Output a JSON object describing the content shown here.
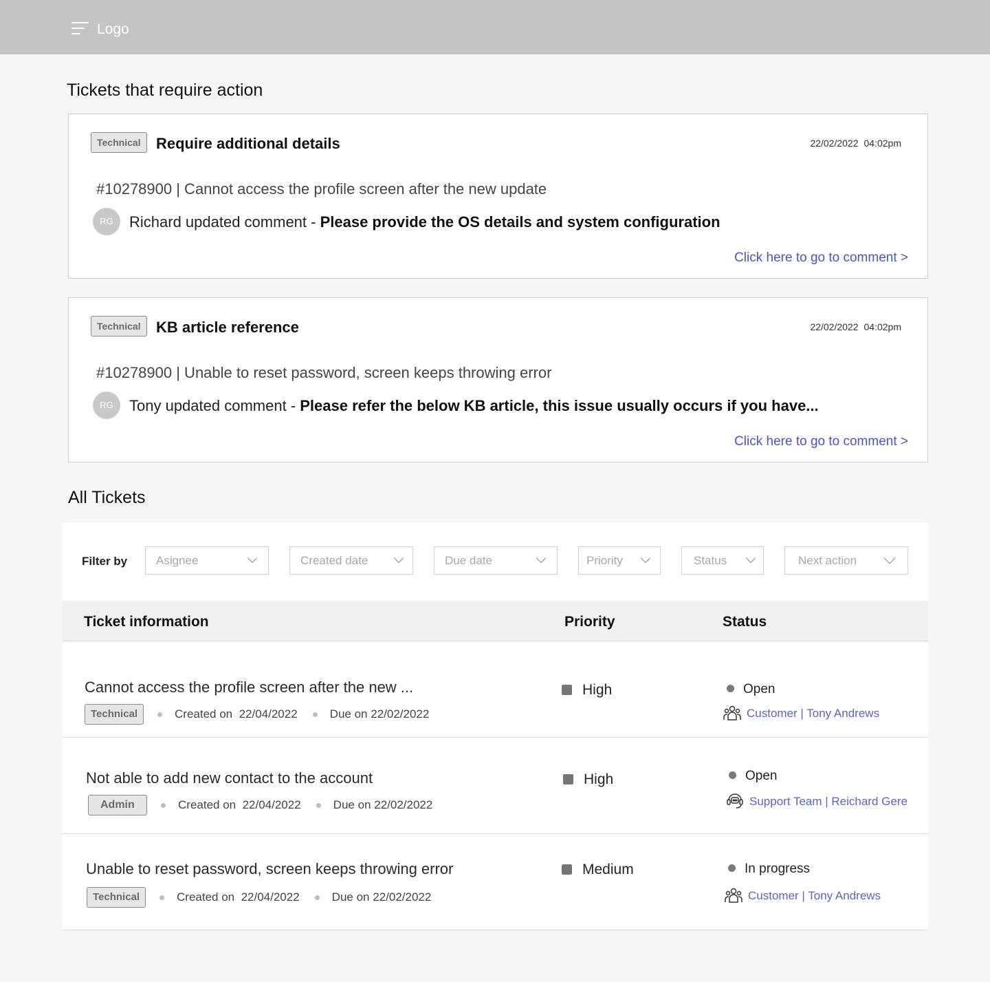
{
  "header": {
    "logo": "Logo"
  },
  "action_section": {
    "title": "Tickets that require action",
    "cards": [
      {
        "badge": "Technical",
        "title": "Require additional details",
        "date": "22/02/2022",
        "time": "04:02pm",
        "ticket": "#10278900 | Cannot access the profile screen after the new update",
        "avatar": "RG",
        "comment_prefix": "Richard updated comment - ",
        "comment": "Please provide the OS details and system configuration",
        "link": "Click here to go to comment >"
      },
      {
        "badge": "Technical",
        "title": "KB article reference",
        "date": "22/02/2022",
        "time": "04:02pm",
        "ticket": "#10278900 | Unable to reset password, screen keeps throwing error",
        "avatar": "RG",
        "comment_prefix": "Tony updated comment - ",
        "comment": "Please refer the below KB article, this issue usually occurs if you have...",
        "link": "Click here to go to comment >"
      }
    ]
  },
  "all_tickets": {
    "title": "All Tickets",
    "filter_label": "Filter by",
    "filters": [
      "Asignee",
      "Created date",
      "Due date",
      "Priority",
      "Status",
      "Next action"
    ],
    "columns": [
      "Ticket information",
      "Priority",
      "Status"
    ],
    "created_prefix": "Created on",
    "due_prefix": "Due on",
    "rows": [
      {
        "title": "Cannot access the profile screen after the new ...",
        "badge": "Technical",
        "created": "22/04/2022",
        "due": "22/02/2022",
        "priority": "High",
        "status": "Open",
        "assignee_icon": "group-icon",
        "assignee": "Customer | Tony Andrews"
      },
      {
        "title": "Not able to add new contact to the account",
        "badge": "Admin",
        "created": "22/04/2022",
        "due": "22/02/2022",
        "priority": "High",
        "status": "Open",
        "assignee_icon": "headset-icon",
        "assignee": "Support Team | Reichard Gere"
      },
      {
        "title": "Unable to reset password, screen keeps throwing error",
        "badge": "Technical",
        "created": "22/04/2022",
        "due": "22/02/2022",
        "priority": "Medium",
        "status": "In progress",
        "assignee_icon": "group-icon",
        "assignee": "Customer | Tony Andrews"
      }
    ]
  }
}
